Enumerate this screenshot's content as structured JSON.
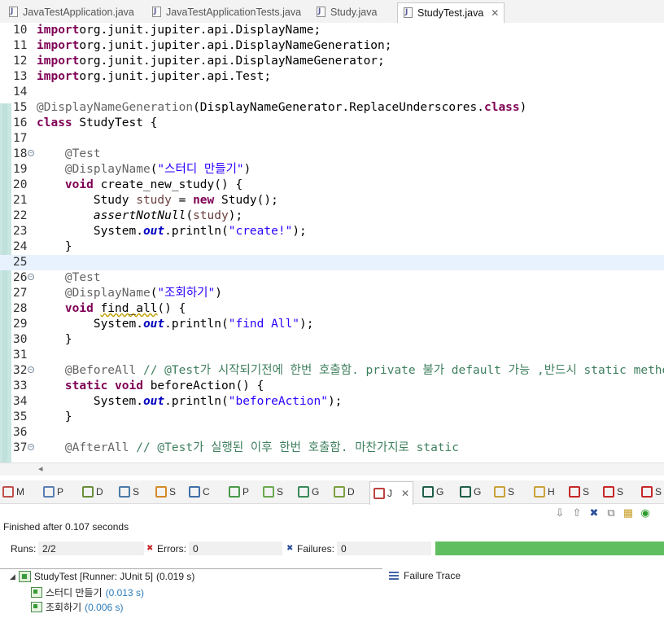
{
  "editor_tabs": [
    {
      "label": "JavaTestApplication.java",
      "active": false
    },
    {
      "label": "JavaTestApplicationTests.java",
      "active": false
    },
    {
      "label": "Study.java",
      "active": false
    },
    {
      "label": "StudyTest.java",
      "active": true
    }
  ],
  "close_glyph": "✕",
  "code_lines": [
    {
      "n": "10",
      "fold": false,
      "parts": [
        [
          "kw",
          "import"
        ],
        [
          "",
          "org.junit.jupiter.api.DisplayName;"
        ]
      ]
    },
    {
      "n": "11",
      "fold": false,
      "parts": [
        [
          "kw",
          "import"
        ],
        [
          "",
          "org.junit.jupiter.api.DisplayNameGeneration;"
        ]
      ]
    },
    {
      "n": "12",
      "fold": false,
      "parts": [
        [
          "kw",
          "import"
        ],
        [
          "",
          "org.junit.jupiter.api.DisplayNameGenerator;"
        ]
      ]
    },
    {
      "n": "13",
      "fold": false,
      "parts": [
        [
          "kw",
          "import"
        ],
        [
          "",
          "org.junit.jupiter.api.Test;"
        ]
      ]
    },
    {
      "n": "14",
      "fold": false,
      "parts": []
    },
    {
      "n": "15",
      "fold": false,
      "parts": [
        [
          "ann",
          "@DisplayNameGeneration"
        ],
        [
          "",
          "(DisplayNameGenerator.ReplaceUnderscores."
        ],
        [
          "kw",
          "class"
        ],
        [
          "",
          ")"
        ]
      ]
    },
    {
      "n": "16",
      "fold": false,
      "parts": [
        [
          "kw",
          "class"
        ],
        [
          "",
          " StudyTest {"
        ]
      ]
    },
    {
      "n": "17",
      "fold": false,
      "parts": []
    },
    {
      "n": "18",
      "fold": true,
      "parts": [
        [
          "",
          "    "
        ],
        [
          "ann",
          "@Test"
        ]
      ]
    },
    {
      "n": "19",
      "fold": false,
      "parts": [
        [
          "",
          "    "
        ],
        [
          "ann",
          "@DisplayName"
        ],
        [
          "",
          "("
        ],
        [
          "str",
          "\"스터디 만들기\""
        ],
        [
          "",
          ")"
        ]
      ]
    },
    {
      "n": "20",
      "fold": false,
      "parts": [
        [
          "",
          "    "
        ],
        [
          "kw",
          "void"
        ],
        [
          "",
          " create_new_study() {"
        ]
      ]
    },
    {
      "n": "21",
      "fold": false,
      "parts": [
        [
          "",
          "        Study "
        ],
        [
          "var",
          "study"
        ],
        [
          "",
          " = "
        ],
        [
          "kw",
          "new"
        ],
        [
          "",
          " Study();"
        ]
      ]
    },
    {
      "n": "22",
      "fold": false,
      "parts": [
        [
          "",
          "        "
        ],
        [
          "stat",
          "assertNotNull"
        ],
        [
          "",
          "("
        ],
        [
          "var",
          "study"
        ],
        [
          "",
          ");"
        ]
      ]
    },
    {
      "n": "23",
      "fold": false,
      "parts": [
        [
          "",
          "        System."
        ],
        [
          "fld",
          "out"
        ],
        [
          "",
          ".println("
        ],
        [
          "str",
          "\"create!\""
        ],
        [
          "",
          ");"
        ]
      ]
    },
    {
      "n": "24",
      "fold": false,
      "parts": [
        [
          "",
          "    }"
        ]
      ]
    },
    {
      "n": "25",
      "fold": false,
      "hl": true,
      "parts": []
    },
    {
      "n": "26",
      "fold": true,
      "parts": [
        [
          "",
          "    "
        ],
        [
          "ann",
          "@Test"
        ]
      ]
    },
    {
      "n": "27",
      "fold": false,
      "parts": [
        [
          "",
          "    "
        ],
        [
          "ann",
          "@DisplayName"
        ],
        [
          "",
          "("
        ],
        [
          "str",
          "\"조회하기\""
        ],
        [
          "",
          ")"
        ]
      ]
    },
    {
      "n": "28",
      "fold": false,
      "parts": [
        [
          "",
          "    "
        ],
        [
          "kw",
          "void"
        ],
        [
          "",
          " "
        ],
        [
          "squig",
          "find_all"
        ],
        [
          "",
          "() {"
        ]
      ]
    },
    {
      "n": "29",
      "fold": false,
      "parts": [
        [
          "",
          "        System."
        ],
        [
          "fld",
          "out"
        ],
        [
          "",
          ".println("
        ],
        [
          "str",
          "\"find All\""
        ],
        [
          "",
          ");"
        ]
      ]
    },
    {
      "n": "30",
      "fold": false,
      "parts": [
        [
          "",
          "    }"
        ]
      ]
    },
    {
      "n": "31",
      "fold": false,
      "parts": []
    },
    {
      "n": "32",
      "fold": true,
      "parts": [
        [
          "",
          "    "
        ],
        [
          "ann",
          "@BeforeAll"
        ],
        [
          "",
          " "
        ],
        [
          "cmt",
          "// @Test가 시작되기전에 한번 호출함. private 불가 default 가능 ,반드시 static method로 사"
        ]
      ]
    },
    {
      "n": "33",
      "fold": false,
      "parts": [
        [
          "",
          "    "
        ],
        [
          "kw",
          "static"
        ],
        [
          "",
          " "
        ],
        [
          "kw",
          "void"
        ],
        [
          "",
          " beforeAction() {"
        ]
      ]
    },
    {
      "n": "34",
      "fold": false,
      "parts": [
        [
          "",
          "        System."
        ],
        [
          "fld",
          "out"
        ],
        [
          "",
          ".println("
        ],
        [
          "str",
          "\"beforeAction\""
        ],
        [
          "",
          ");"
        ]
      ]
    },
    {
      "n": "35",
      "fold": false,
      "parts": [
        [
          "",
          "    }"
        ]
      ]
    },
    {
      "n": "36",
      "fold": false,
      "parts": []
    },
    {
      "n": "37",
      "fold": true,
      "parts": [
        [
          "",
          "    "
        ],
        [
          "ann",
          "@AfterAll"
        ],
        [
          "",
          " "
        ],
        [
          "cmt",
          "// @Test가 실행된 이후 한번 호출함. 마찬가지로 static"
        ]
      ]
    }
  ],
  "view_tabs": [
    {
      "letter": "M",
      "icon": "markers-icon",
      "color": "#c0504d"
    },
    {
      "letter": "P",
      "icon": "properties-icon",
      "color": "#5b7fb5"
    },
    {
      "letter": "D",
      "icon": "debug-icon",
      "color": "#6a8f3a"
    },
    {
      "letter": "S",
      "icon": "servers-icon",
      "color": "#4b7ba8"
    },
    {
      "letter": "S",
      "icon": "search-icon",
      "color": "#d38a2a"
    },
    {
      "letter": "C",
      "icon": "console-icon",
      "color": "#3f6fa8"
    },
    {
      "letter": "P",
      "icon": "progress-icon",
      "color": "#4a9a4a"
    },
    {
      "letter": "S",
      "icon": "spring-icon",
      "color": "#6aa84f"
    },
    {
      "letter": "G",
      "icon": "gradle-tasks-icon",
      "color": "#3a8a5a"
    },
    {
      "letter": "D",
      "icon": "debug-shell-icon",
      "color": "#7aa040"
    },
    {
      "letter": "J",
      "icon": "junit-icon",
      "color": "#c04040",
      "active": true
    },
    {
      "letter": "G",
      "icon": "gradle-executions-icon",
      "color": "#1f5e4a"
    },
    {
      "letter": "G",
      "icon": "gradle-icon",
      "color": "#1f5e4a"
    },
    {
      "letter": "S",
      "icon": "synchronize-icon",
      "color": "#c9a23a"
    },
    {
      "letter": "H",
      "icon": "history-icon",
      "color": "#c9a23a"
    },
    {
      "letter": "S",
      "icon": "stop-sign-icon",
      "color": "#c62828"
    },
    {
      "letter": "S",
      "icon": "stop-sign2-icon",
      "color": "#c62828"
    },
    {
      "letter": "S",
      "icon": "help-icon",
      "color": "#c62828"
    }
  ],
  "junit": {
    "finished": "Finished after 0.107 seconds",
    "runs_label": "Runs:",
    "runs_value": "2/2",
    "errors_label": "Errors:",
    "errors_value": "0",
    "failures_label": "Failures:",
    "failures_value": "0",
    "progress": 1.0,
    "progress_color": "#5fbe5f",
    "failure_trace": "Failure Trace",
    "suite": {
      "name": "StudyTest [Runner: JUnit 5]",
      "time": "(0.019 s)"
    },
    "tests": [
      {
        "name": "스터디 만들기",
        "time": "(0.013 s)"
      },
      {
        "name": "조회하기",
        "time": "(0.006 s)"
      }
    ]
  }
}
